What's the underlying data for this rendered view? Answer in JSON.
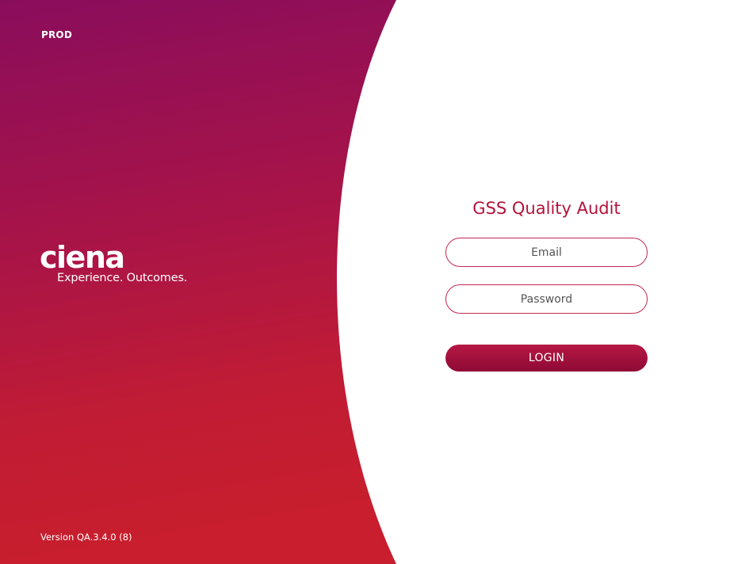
{
  "environment": {
    "label": "PROD"
  },
  "brand": {
    "logo_text": "ciena",
    "tagline": "Experience. Outcomes.",
    "colors": {
      "gradient_top": "#8a0d5c",
      "gradient_bottom": "#c81e2d",
      "accent": "#b3123a"
    }
  },
  "login": {
    "title": "GSS Quality Audit",
    "email_placeholder": "Email",
    "password_placeholder": "Password",
    "login_label": "LOGIN"
  },
  "footer": {
    "version": "Version QA.3.4.0 (8)"
  }
}
